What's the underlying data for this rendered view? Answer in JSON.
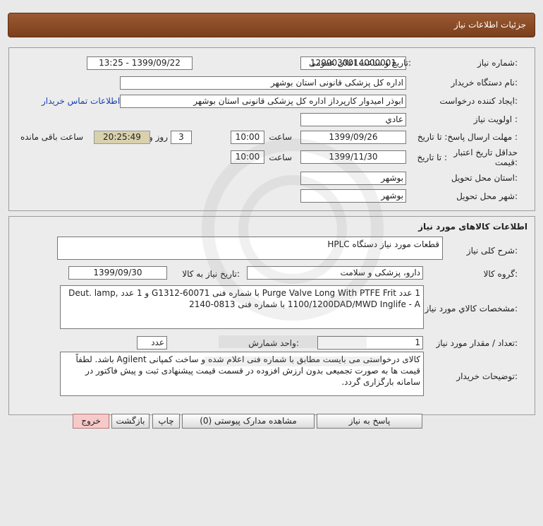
{
  "header": {
    "title": "جزئیات اطلاعات نیاز"
  },
  "need_info": {
    "need_number_label": "شماره نیاز:",
    "need_number": "1299030014000001",
    "announce_label": "تاریخ و ساعت اعلان عمومی:",
    "announce_value": "1399/09/22 - 13:25",
    "buyer_org_label": "نام دستگاه خریدار:",
    "buyer_org": "اداره کل پزشکی قانونی  استان بوشهر",
    "requester_label": "ایجاد کننده درخواست:",
    "requester": "ابوذر امیدوار کارپرداز اداره کل پزشکی قانونی  استان بوشهر",
    "contact_link": "اطلاعات تماس خریدار",
    "priority_label": "اولویت نیاز :",
    "priority": "عادي",
    "deadline_label": "مهلت ارسال پاسخ:  تا تاریخ :",
    "deadline_date": "1399/09/26",
    "time_label": "ساعت",
    "deadline_time": "10:00",
    "days_value": "3",
    "days_label": "روز و",
    "remaining_time": "20:25:49",
    "remaining_label": "ساعت باقی مانده",
    "validity_label_1": "حداقل تاریخ اعتبار",
    "validity_label_2": "قیمت:",
    "validity_to_label": "تا تاریخ :",
    "validity_date": "1399/11/30",
    "validity_time": "10:00",
    "province_label": "استان محل تحویل:",
    "province": "بوشهر",
    "city_label": "شهر محل تحویل:",
    "city": "بوشهر"
  },
  "goods": {
    "section_title": "اطلاعات کالاهای مورد نیاز",
    "summary_label": "شرح کلی نیاز:",
    "summary": "قطعات مورد نیاز دستگاه HPLC",
    "group_label": "گروه کالا:",
    "group": "دارو، پزشکی و سلامت",
    "need_date_label": "تاریخ نیاز به کالا:",
    "need_date": "1399/09/30",
    "specs_label": "مشخصات کالاي مورد نياز:",
    "specs": "1 عدد Purge Valve Long With PTFE Frit با شماره فنی G1312-60071 و 1 عدد Deut. lamp, 1100/1200DAD/MWD Inglife - A با شماره فنی 0813-2140",
    "qty_label": "تعداد / مقدار مورد نیاز:",
    "qty": "1",
    "unit_label": "واحد شمارش:",
    "unit": "عدد",
    "notes_label": "توضیحات خریدار:",
    "notes": "کالای درخواستی می بایست مطابق با شماره فنی اعلام شده و ساخت کمپانی Agilent باشد. لطفاً قیمت ها به صورت تجمیعی بدون ارزش افزوده در قسمت قیمت پیشنهادی ثبت و پیش فاکتور در سامانه بارگزاری گردد."
  },
  "buttons": {
    "reply": "پاسخ به نیاز",
    "attachments": "مشاهده مدارک پیوستی (0)",
    "print": "چاپ",
    "back": "بازگشت",
    "exit": "خروج"
  }
}
